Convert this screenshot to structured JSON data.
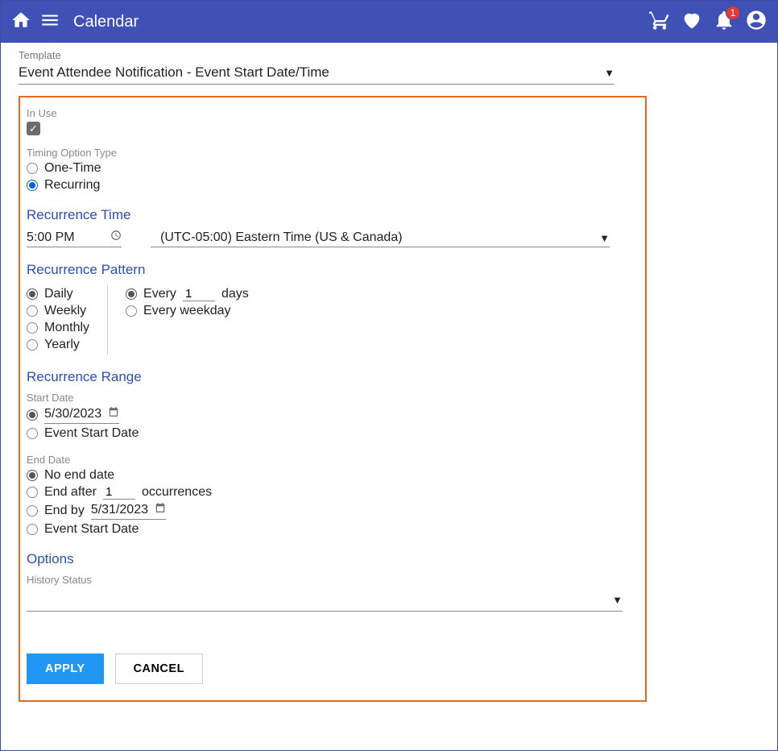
{
  "appbar": {
    "title": "Calendar",
    "badge": "1"
  },
  "template": {
    "label": "Template",
    "value": "Event Attendee Notification - Event Start Date/Time"
  },
  "inUse": {
    "label": "In Use",
    "checked": true
  },
  "timingType": {
    "label": "Timing Option Type",
    "options": {
      "onetime": "One-Time",
      "recurring": "Recurring"
    }
  },
  "recurrenceTime": {
    "heading": "Recurrence Time",
    "time": "5:00 PM",
    "tz": "(UTC-05:00) Eastern Time (US & Canada)"
  },
  "pattern": {
    "heading": "Recurrence Pattern",
    "period": {
      "daily": "Daily",
      "weekly": "Weekly",
      "monthly": "Monthly",
      "yearly": "Yearly"
    },
    "every": {
      "prefix": "Every",
      "value": "1",
      "suffix": "days"
    },
    "weekday": "Every weekday"
  },
  "range": {
    "heading": "Recurrence Range",
    "startLabel": "Start Date",
    "startDate": "5/30/2023",
    "eventStart": "Event Start Date",
    "endLabel": "End Date",
    "noEnd": "No end date",
    "endAfterPrefix": "End after",
    "endAfterValue": "1",
    "endAfterSuffix": "occurrences",
    "endByPrefix": "End by",
    "endByDate": "5/31/2023"
  },
  "options": {
    "heading": "Options",
    "historyLabel": "History Status"
  },
  "buttons": {
    "apply": "APPLY",
    "cancel": "CANCEL"
  }
}
